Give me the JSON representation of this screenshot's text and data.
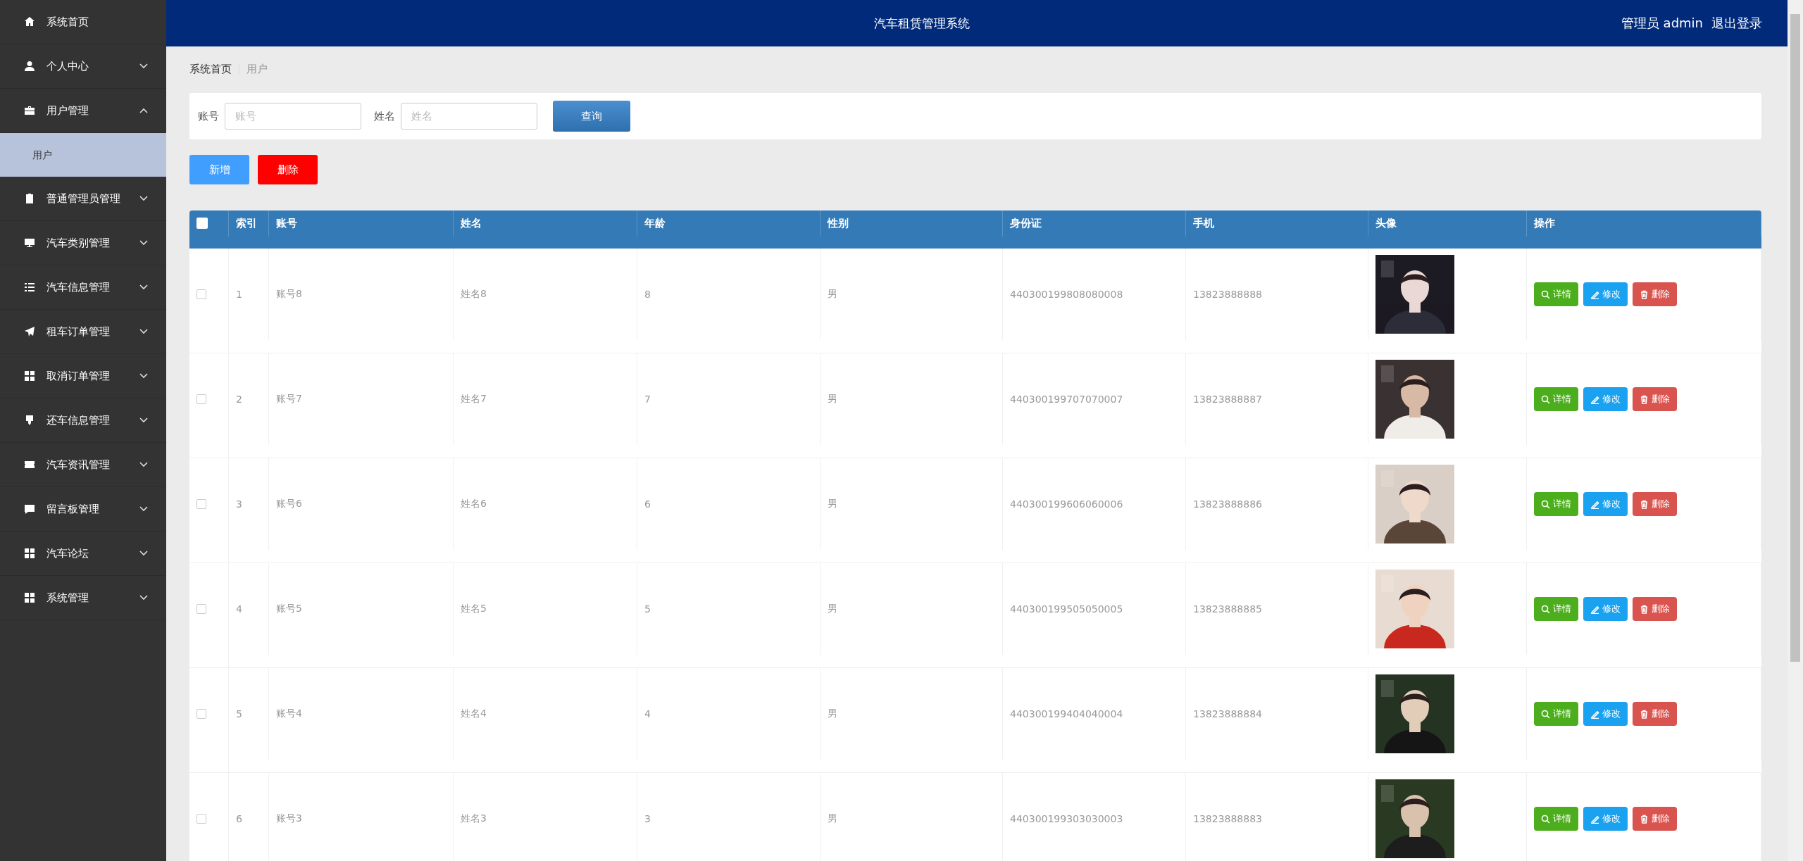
{
  "sidebar": {
    "items": [
      {
        "label": "系统首页",
        "kind": "link"
      },
      {
        "label": "个人中心",
        "kind": "menu",
        "expanded": false
      },
      {
        "label": "用户管理",
        "kind": "menu",
        "expanded": true,
        "children": [
          {
            "label": "用户",
            "selected": true
          }
        ]
      },
      {
        "label": "普通管理员管理",
        "kind": "menu",
        "expanded": false
      },
      {
        "label": "汽车类别管理",
        "kind": "menu",
        "expanded": false
      },
      {
        "label": "汽车信息管理",
        "kind": "menu",
        "expanded": false
      },
      {
        "label": "租车订单管理",
        "kind": "menu",
        "expanded": false
      },
      {
        "label": "取消订单管理",
        "kind": "menu",
        "expanded": false
      },
      {
        "label": "还车信息管理",
        "kind": "menu",
        "expanded": false
      },
      {
        "label": "汽车资讯管理",
        "kind": "menu",
        "expanded": false
      },
      {
        "label": "留言板管理",
        "kind": "menu",
        "expanded": false
      },
      {
        "label": "汽车论坛",
        "kind": "menu",
        "expanded": false
      },
      {
        "label": "系统管理",
        "kind": "menu",
        "expanded": false
      }
    ]
  },
  "header": {
    "title": "汽车租赁管理系统",
    "user": "管理员 admin",
    "logout": "退出登录"
  },
  "breadcrumb": [
    "系统首页",
    "用户"
  ],
  "search": {
    "fields": [
      {
        "label": "账号",
        "placeholder": "账号"
      },
      {
        "label": "姓名",
        "placeholder": "姓名"
      }
    ],
    "button": "查询"
  },
  "actions": [
    {
      "label": "新增",
      "kind": "add"
    },
    {
      "label": "删除",
      "kind": "delete"
    }
  ],
  "table": {
    "select_all": {
      "checked": false
    },
    "columns": [
      "索引",
      "账号",
      "姓名",
      "年龄",
      "性别",
      "身份证",
      "手机",
      "头像",
      "操作"
    ],
    "rows": [
      {
        "checked": false,
        "cells": [
          "1",
          "账号8",
          "姓名8",
          "8",
          "男",
          "440300199808080008",
          "13823888888"
        ],
        "actions": [
          {
            "label": "详情",
            "kind": "detail"
          },
          {
            "label": "修改",
            "kind": "edit"
          },
          {
            "label": "删除",
            "kind": "delete"
          }
        ]
      },
      {
        "checked": false,
        "cells": [
          "2",
          "账号7",
          "姓名7",
          "7",
          "男",
          "440300199707070007",
          "13823888887"
        ],
        "actions": [
          {
            "label": "详情",
            "kind": "detail"
          },
          {
            "label": "修改",
            "kind": "edit"
          },
          {
            "label": "删除",
            "kind": "delete"
          }
        ]
      },
      {
        "checked": false,
        "cells": [
          "3",
          "账号6",
          "姓名6",
          "6",
          "男",
          "440300199606060006",
          "13823888886"
        ],
        "actions": [
          {
            "label": "详情",
            "kind": "detail"
          },
          {
            "label": "修改",
            "kind": "edit"
          },
          {
            "label": "删除",
            "kind": "delete"
          }
        ]
      },
      {
        "checked": false,
        "cells": [
          "4",
          "账号5",
          "姓名5",
          "5",
          "男",
          "440300199505050005",
          "13823888885"
        ],
        "actions": [
          {
            "label": "详情",
            "kind": "detail"
          },
          {
            "label": "修改",
            "kind": "edit"
          },
          {
            "label": "删除",
            "kind": "delete"
          }
        ]
      },
      {
        "checked": false,
        "cells": [
          "5",
          "账号4",
          "姓名4",
          "4",
          "男",
          "440300199404040004",
          "13823888884"
        ],
        "actions": [
          {
            "label": "详情",
            "kind": "detail"
          },
          {
            "label": "修改",
            "kind": "edit"
          },
          {
            "label": "删除",
            "kind": "delete"
          }
        ]
      },
      {
        "checked": false,
        "cells": [
          "6",
          "账号3",
          "姓名3",
          "3",
          "男",
          "440300199303030003",
          "13823888883"
        ],
        "actions": [
          {
            "label": "详情",
            "kind": "detail"
          },
          {
            "label": "修改",
            "kind": "edit"
          },
          {
            "label": "删除",
            "kind": "delete"
          }
        ]
      }
    ]
  }
}
